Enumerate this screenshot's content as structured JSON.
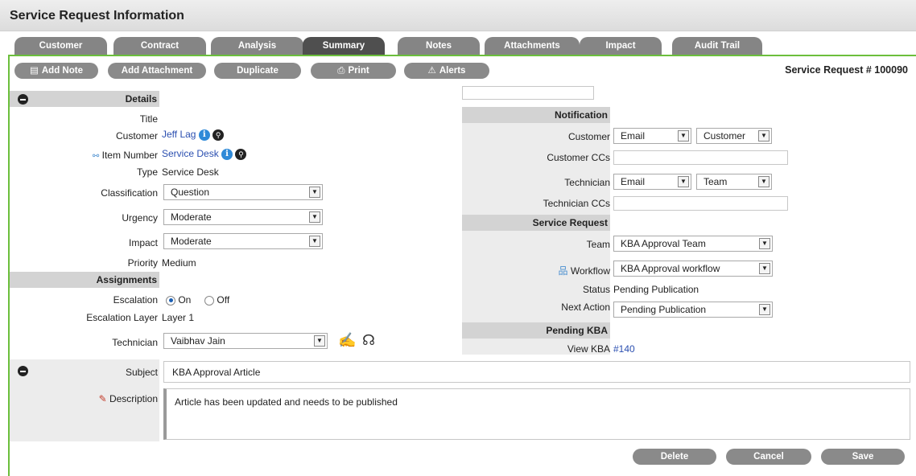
{
  "header": {
    "title": "Service Request Information"
  },
  "tabs": [
    {
      "label": "Customer",
      "active": false
    },
    {
      "label": "Contract",
      "active": false
    },
    {
      "label": "Analysis",
      "active": false
    },
    {
      "label": "Summary",
      "active": true
    },
    {
      "label": "Notes",
      "active": false
    },
    {
      "label": "Attachments",
      "active": false
    },
    {
      "label": "Impact",
      "active": false
    },
    {
      "label": "Audit Trail",
      "active": false
    }
  ],
  "toolbar": {
    "add_note": "Add Note",
    "add_attachment": "Add Attachment",
    "duplicate": "Duplicate",
    "print": "Print",
    "alerts": "Alerts"
  },
  "request_number": "Service Request # 100090",
  "details": {
    "heading": "Details",
    "title_label": "Title",
    "customer_label": "Customer",
    "customer_value": "Jeff Lag",
    "item_label": "Item Number",
    "item_value": "Service Desk",
    "type_label": "Type",
    "type_value": "Service Desk",
    "classification_label": "Classification",
    "classification_value": "Question",
    "urgency_label": "Urgency",
    "urgency_value": "Moderate",
    "impact_label": "Impact",
    "impact_value": "Moderate",
    "priority_label": "Priority",
    "priority_value": "Medium"
  },
  "assignments": {
    "heading": "Assignments",
    "escalation_label": "Escalation",
    "on_label": "On",
    "off_label": "Off",
    "layer_label": "Escalation Layer",
    "layer_value": "Layer 1",
    "technician_label": "Technician",
    "technician_value": "Vaibhav Jain"
  },
  "notification": {
    "heading": "Notification",
    "customer_label": "Customer",
    "customer_method": "Email",
    "customer_target": "Customer",
    "customer_ccs_label": "Customer CCs",
    "technician_label": "Technician",
    "technician_method": "Email",
    "technician_target": "Team",
    "technician_ccs_label": "Technician CCs"
  },
  "service_request": {
    "heading": "Service Request",
    "team_label": "Team",
    "team_value": "KBA Approval Team",
    "workflow_label": "Workflow",
    "workflow_value": "KBA Approval workflow",
    "status_label": "Status",
    "status_value": "Pending Publication",
    "next_action_label": "Next Action",
    "next_action_value": "Pending Publication"
  },
  "pending_kba": {
    "heading": "Pending KBA",
    "view_label": "View KBA",
    "view_value": "#140"
  },
  "subject": {
    "label": "Subject",
    "value": "KBA Approval Article"
  },
  "description": {
    "label": "Description",
    "value": "Article has been updated and needs to be published"
  },
  "footer": {
    "delete": "Delete",
    "cancel": "Cancel",
    "save": "Save"
  }
}
